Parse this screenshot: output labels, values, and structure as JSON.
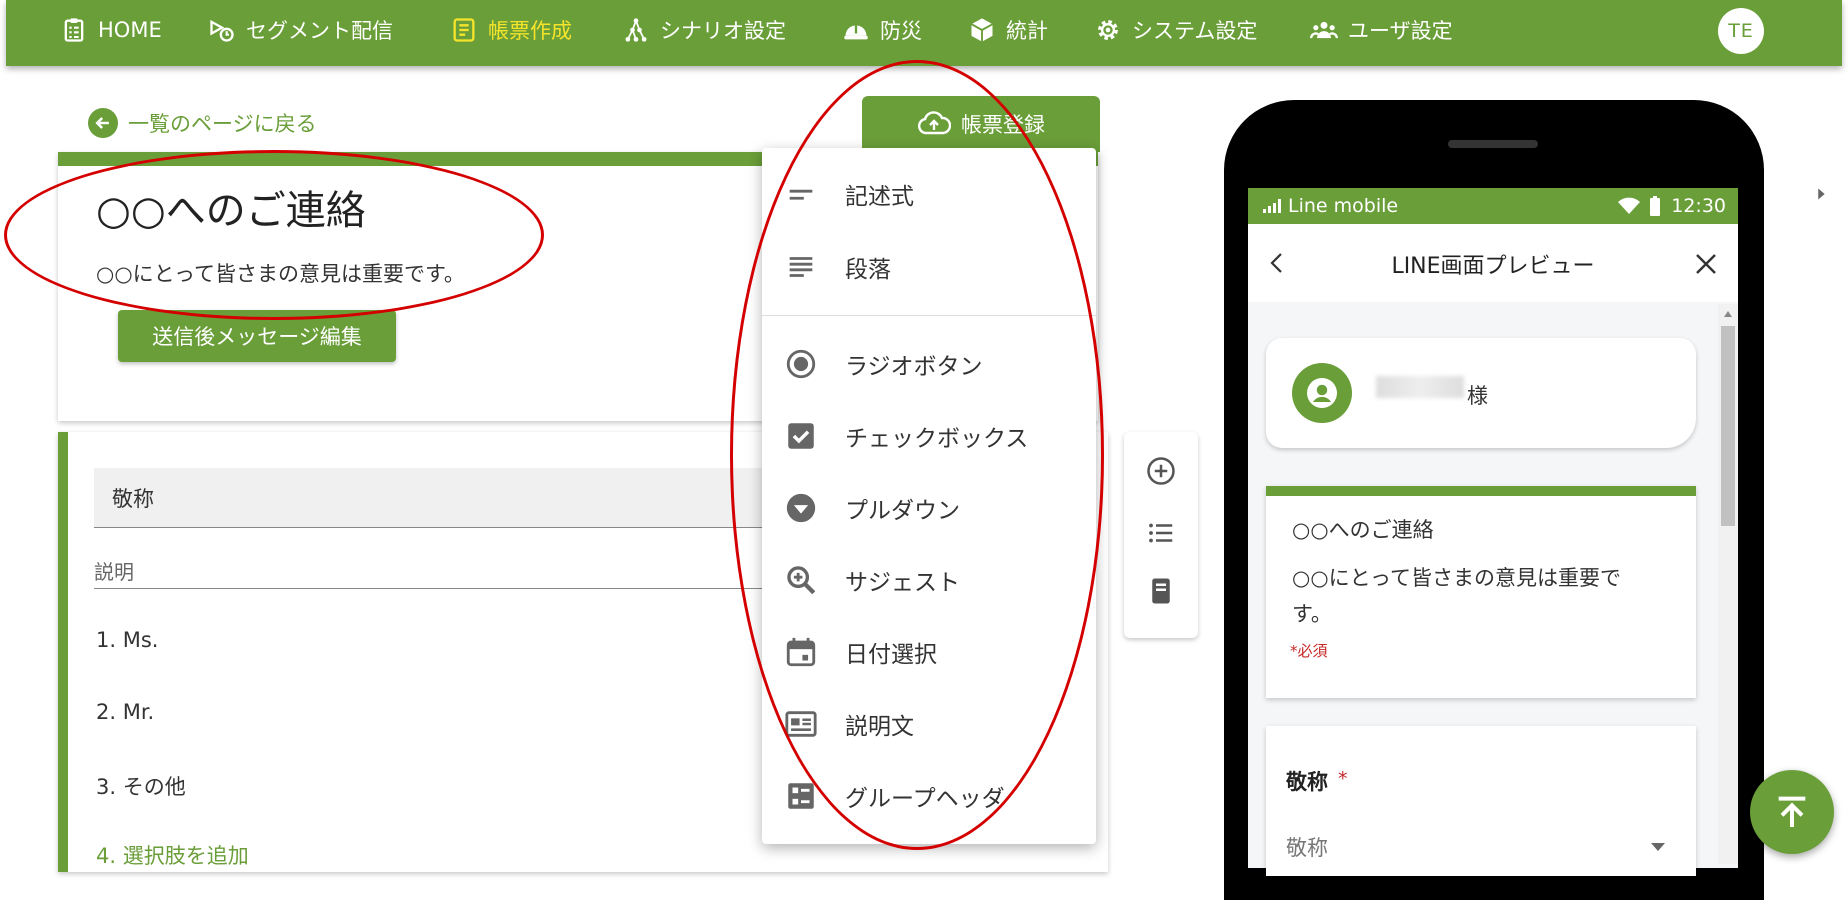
{
  "nav": {
    "items": [
      {
        "label": "HOME",
        "icon": "clipboard-icon"
      },
      {
        "label": "セグメント配信",
        "icon": "segment-send-icon"
      },
      {
        "label": "帳票作成",
        "icon": "form-icon",
        "active": true
      },
      {
        "label": "シナリオ設定",
        "icon": "scenario-icon"
      },
      {
        "label": "防災",
        "icon": "helmet-icon"
      },
      {
        "label": "統計",
        "icon": "cube-icon"
      },
      {
        "label": "システム設定",
        "icon": "gear-icon"
      },
      {
        "label": "ユーザ設定",
        "icon": "users-icon"
      }
    ],
    "avatar": "TE"
  },
  "colors": {
    "brand": "#6a9e39",
    "active_nav": "#f5e42a",
    "annotation": "#d40000",
    "required": "#c62828"
  },
  "back_link": "一覧のページに戻る",
  "register_button": "帳票登録",
  "form": {
    "title": "○○へのご連絡",
    "description": "○○にとって皆さまの意見は重要です。",
    "send_message_button": "送信後メッセージ編集"
  },
  "question": {
    "title": "敬称",
    "description_placeholder": "説明",
    "options": [
      "1.  Ms.",
      "2.  Mr.",
      "3.  その他"
    ],
    "add_option": "4. 選択肢を追加"
  },
  "menu": {
    "items": [
      {
        "label": "記述式",
        "icon": "short-text-icon",
        "submenu": true
      },
      {
        "label": "段落",
        "icon": "paragraph-icon"
      },
      {
        "label": "ラジオボタン",
        "icon": "radio-button-icon"
      },
      {
        "label": "チェックボックス",
        "icon": "checkbox-icon"
      },
      {
        "label": "プルダウン",
        "icon": "dropdown-icon"
      },
      {
        "label": "サジェスト",
        "icon": "zoom-in-icon"
      },
      {
        "label": "日付選択",
        "icon": "calendar-icon"
      },
      {
        "label": "説明文",
        "icon": "description-icon"
      },
      {
        "label": "グループヘッダ",
        "icon": "group-header-icon"
      }
    ]
  },
  "toolbar": {
    "icons": [
      "add-circle-icon",
      "list-icon",
      "page-icon"
    ]
  },
  "preview": {
    "carrier": "Line mobile",
    "time": "12:30",
    "header_title": "LINE画面プレビュー",
    "user_suffix": "様",
    "card_title": "○○へのご連絡",
    "card_desc": "○○にとって皆さまの意見は重要です。",
    "required_note": "*必須",
    "question_label": "敬称",
    "question_required_mark": "*",
    "select_placeholder": "敬称"
  }
}
